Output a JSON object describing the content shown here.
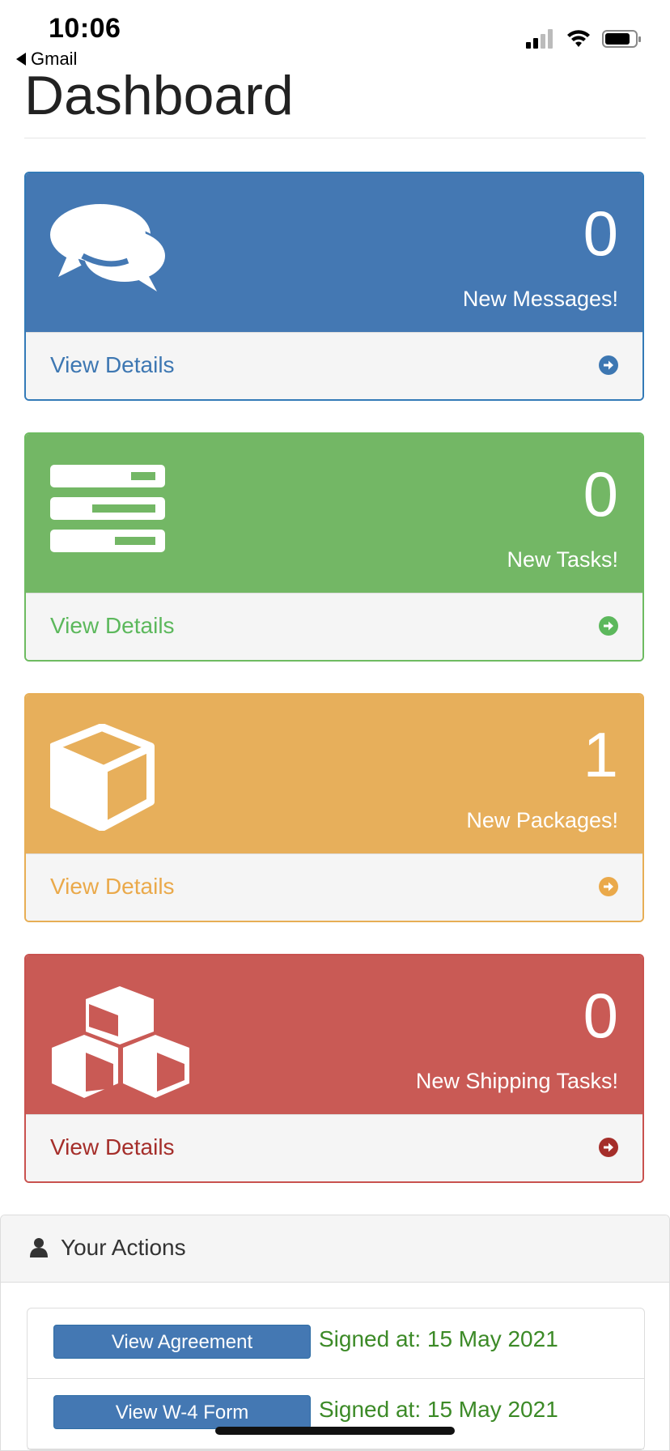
{
  "status_bar": {
    "time": "10:06",
    "back_app": "Gmail"
  },
  "page": {
    "title": "Dashboard"
  },
  "panels": [
    {
      "icon": "comments-icon",
      "count": "0",
      "label": "New Messages!",
      "details": "View Details",
      "color": "#4478b3"
    },
    {
      "icon": "tasks-icon",
      "count": "0",
      "label": "New Tasks!",
      "details": "View Details",
      "color": "#73b765"
    },
    {
      "icon": "cube-icon",
      "count": "1",
      "label": "New Packages!",
      "details": "View Details",
      "color": "#e7af5b"
    },
    {
      "icon": "cubes-icon",
      "count": "0",
      "label": "New Shipping Tasks!",
      "details": "View Details",
      "color": "#c95a55"
    }
  ],
  "actions": {
    "title": "Your Actions",
    "items": [
      {
        "button": "View Agreement",
        "signed": "Signed at: 15 May 2021"
      },
      {
        "button": "View W-4 Form",
        "signed": "Signed at: 15 May 2021"
      }
    ]
  }
}
